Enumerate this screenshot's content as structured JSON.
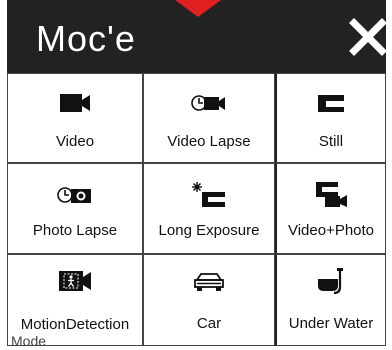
{
  "header": {
    "title": "Moc'e",
    "close_icon": "close-icon"
  },
  "colors": {
    "header_bg": "#222222",
    "pointer": "#e02020",
    "text": "#111111"
  },
  "modes": [
    {
      "label": "Video",
      "icon": "video-camera-icon"
    },
    {
      "label": "Video Lapse",
      "icon": "video-lapse-icon"
    },
    {
      "label": "Still",
      "icon": "still-camera-icon"
    },
    {
      "label": "Photo Lapse",
      "icon": "photo-lapse-icon"
    },
    {
      "label": "Long Exposure",
      "icon": "long-exposure-icon"
    },
    {
      "label": "Video+Photo",
      "icon": "video-photo-icon"
    },
    {
      "label": "MotionDetection",
      "label2": "Mode",
      "icon": "motion-detection-icon"
    },
    {
      "label": "Car",
      "icon": "car-icon"
    },
    {
      "label": "Under Water",
      "icon": "underwater-icon"
    }
  ]
}
